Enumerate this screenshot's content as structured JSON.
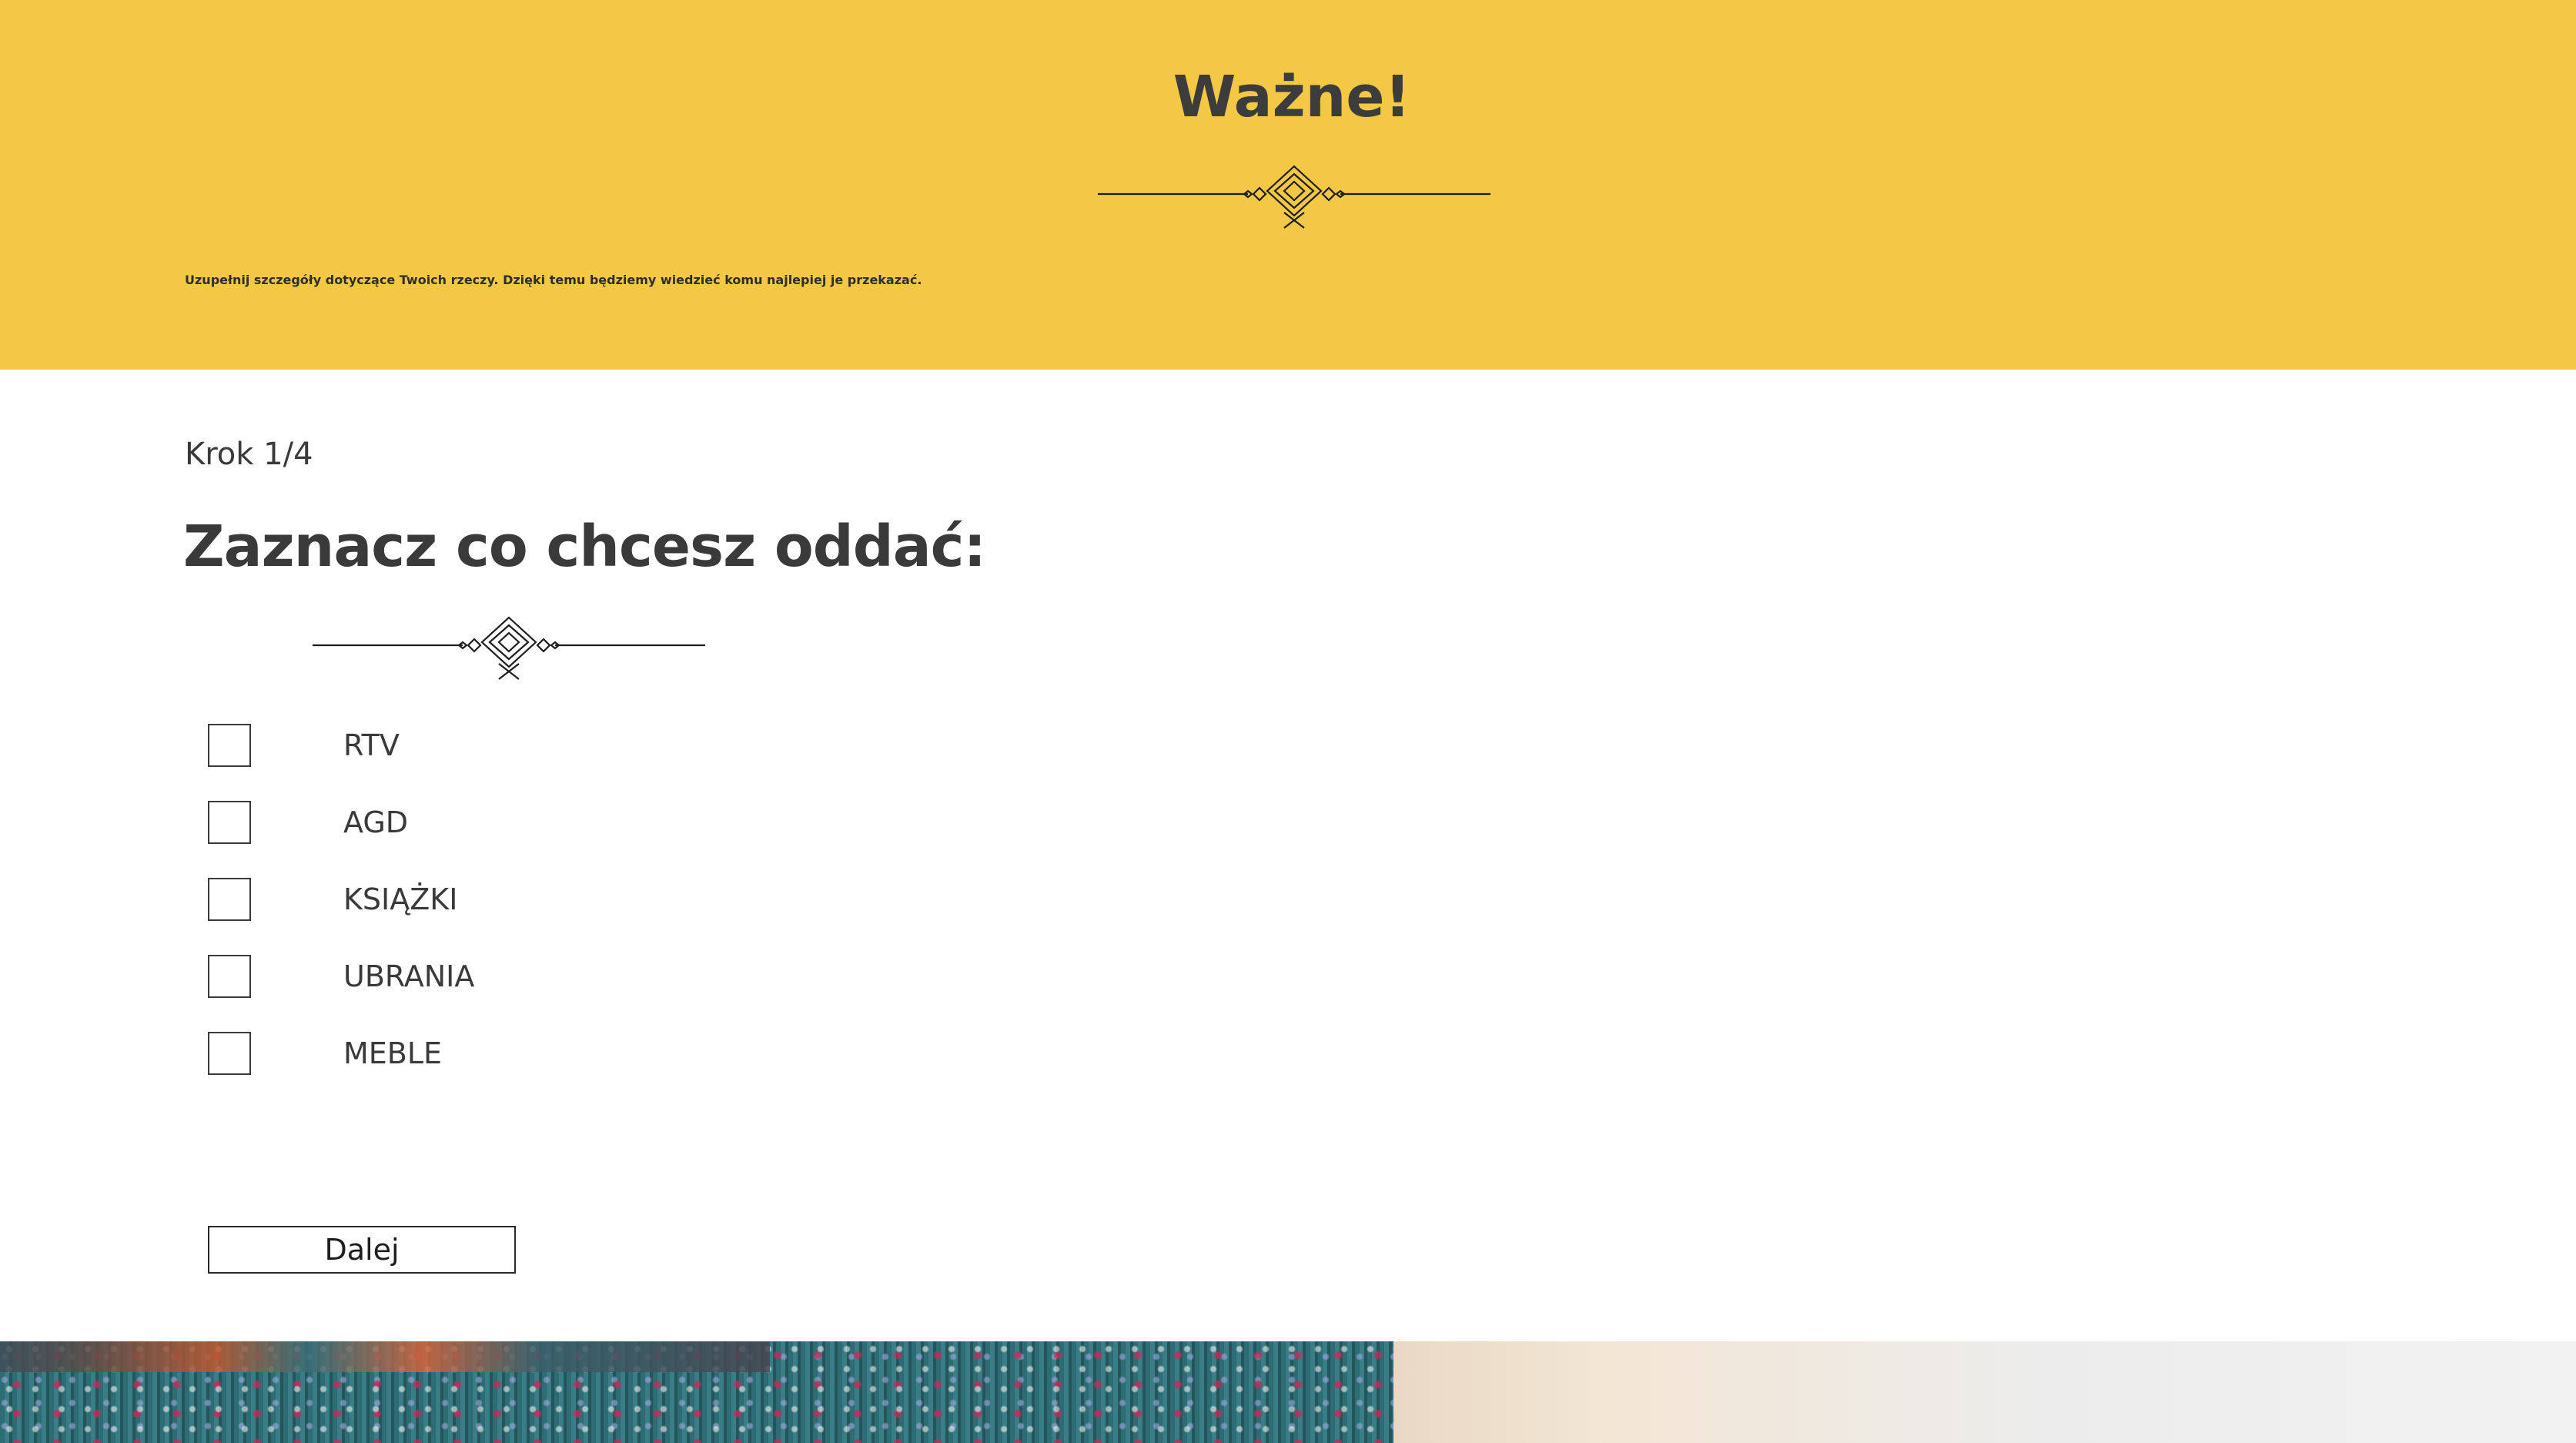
{
  "banner": {
    "title": "Ważne!",
    "note": "Uzupełnij szczegóły dotyczące Twoich rzeczy. Dzięki temu będziemy wiedzieć komu najlepiej je przekazać.",
    "background_color": "#f2c844"
  },
  "form": {
    "step_label": "Krok 1/4",
    "title": "Zaznacz co chcesz oddać:",
    "options": [
      {
        "label": "RTV",
        "checked": false
      },
      {
        "label": "AGD",
        "checked": false
      },
      {
        "label": "KSIĄŻKI",
        "checked": false
      },
      {
        "label": "UBRANIA",
        "checked": false
      },
      {
        "label": "MEBLE",
        "checked": false
      }
    ],
    "next_label": "Dalej"
  },
  "icons": {
    "decoration": "ornamental-divider-icon",
    "checkbox": "checkbox-empty"
  }
}
